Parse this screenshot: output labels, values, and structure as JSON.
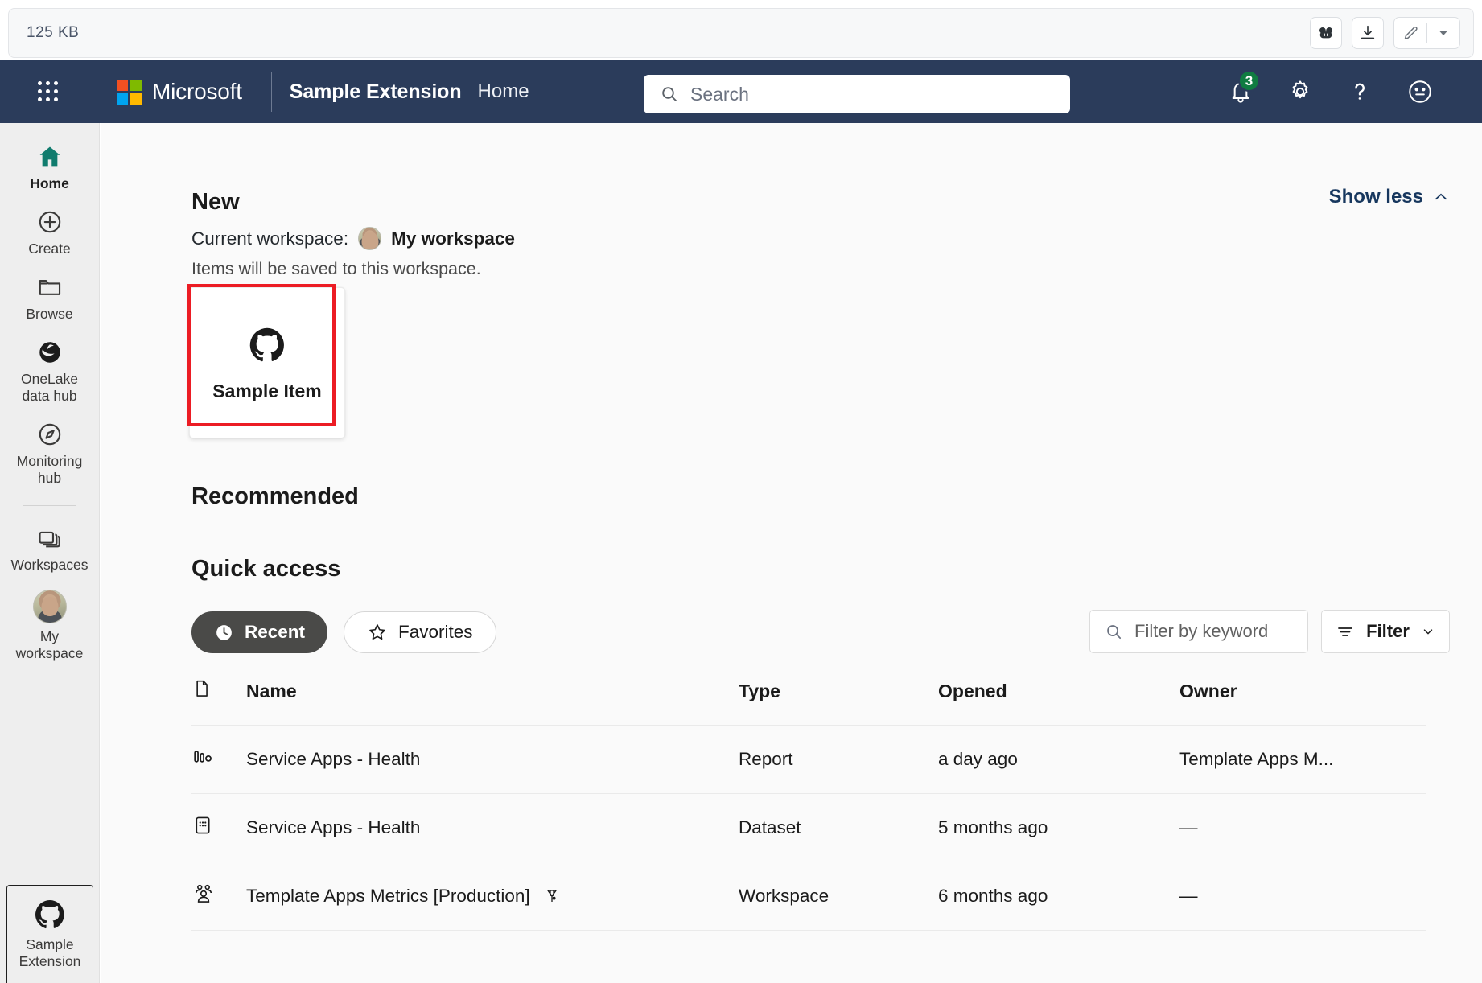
{
  "viewer": {
    "file_size": "125 KB",
    "tools": [
      {
        "name": "copilot-icon",
        "label": "Copilot"
      },
      {
        "name": "download-icon",
        "label": "Download"
      },
      {
        "name": "edit-icon",
        "label": "Edit"
      },
      {
        "name": "chevron-down-icon",
        "label": "More"
      }
    ]
  },
  "topnav": {
    "waffle_label": "App launcher",
    "brand_company": "Microsoft",
    "brand_product": "Sample Extension",
    "home_label": "Home",
    "search_placeholder": "Search",
    "notification_count": "3",
    "notification_badge_color": "#107c41",
    "bar_color": "#2b3c5b",
    "icons": [
      "bell-icon",
      "gear-icon",
      "help-icon",
      "feedback-smiley-icon"
    ]
  },
  "sidebar": {
    "items": [
      {
        "label": "Home",
        "icon": "home-icon",
        "active": true
      },
      {
        "label": "Create",
        "icon": "plus-circle-icon",
        "active": false
      },
      {
        "label": "Browse",
        "icon": "folder-icon",
        "active": false
      },
      {
        "label": "OneLake\ndata hub",
        "icon": "onelake-icon",
        "active": false
      },
      {
        "label": "Monitoring\nhub",
        "icon": "compass-icon",
        "active": false
      },
      {
        "label": "Workspaces",
        "icon": "workspaces-icon",
        "active": false
      },
      {
        "label": "My\nworkspace",
        "icon": "avatar-icon",
        "active": false
      }
    ],
    "bottom_item": {
      "label": "Sample\nExtension",
      "icon": "github-octocat-icon"
    },
    "accent_color": "#107c6e"
  },
  "main": {
    "new": {
      "title": "New",
      "current_workspace_label": "Current workspace:",
      "workspace_name": "My workspace",
      "note": "Items will be saved to this workspace.",
      "show_less": "Show less"
    },
    "new_items": [
      {
        "name": "Sample Item",
        "icon": "github-octocat-icon",
        "highlighted": true,
        "highlight_color": "#ec1c24"
      }
    ],
    "recommended_title": "Recommended",
    "quick_access": {
      "title": "Quick access",
      "tabs": [
        {
          "label": "Recent",
          "icon": "clock-icon",
          "selected": true
        },
        {
          "label": "Favorites",
          "icon": "star-icon",
          "selected": false
        }
      ],
      "filter_placeholder": "Filter by keyword",
      "filter_button": "Filter",
      "columns": [
        "Name",
        "Type",
        "Opened",
        "Owner"
      ],
      "rows": [
        {
          "icon": "report-chart-icon",
          "name": "Service Apps - Health",
          "badge_icon": "",
          "type": "Report",
          "opened": "a day ago",
          "owner": "Template Apps M..."
        },
        {
          "icon": "dataset-grid-icon",
          "name": "Service Apps - Health",
          "badge_icon": "",
          "type": "Dataset",
          "opened": "5 months ago",
          "owner": "—"
        },
        {
          "icon": "workspace-people-icon",
          "name": "Template Apps Metrics [Production]",
          "badge_icon": "premium-diamond-icon",
          "type": "Workspace",
          "opened": "6 months ago",
          "owner": "—"
        }
      ]
    }
  }
}
